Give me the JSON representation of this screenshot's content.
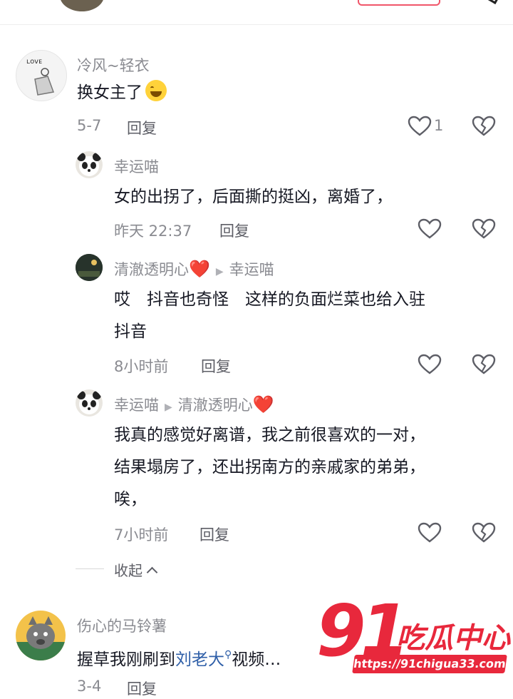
{
  "comments": [
    {
      "username": "冷风~轻衣",
      "text": "换女主了",
      "emoji": "sweat-smile-emoji",
      "time": "5-7",
      "reply": "回复",
      "likes": "1"
    },
    {
      "username": "幸运喵",
      "text": "女的出拐了，后面撕的挺凶，离婚了，",
      "time": "昨天 22:37",
      "reply": "回复"
    },
    {
      "username": "清澈透明心",
      "heart": "❤️",
      "reply_to": "幸运喵",
      "text_line1": "哎　抖音也奇怪　这样的负面烂菜也给入驻",
      "text_line2": "抖音",
      "time": "8小时前",
      "reply": "回复"
    },
    {
      "username": "幸运喵",
      "reply_to": "清澈透明心",
      "heart": "❤️",
      "text_line1": "我真的感觉好离谱，我之前很喜欢的一对，",
      "text_line2": "结果塌房了，还出拐南方的亲戚家的弟弟，",
      "text_line3": "唉，",
      "time": "7小时前",
      "reply": "回复"
    },
    {
      "username": "伤心的马铃薯",
      "text_prefix": "握草我刚刷到",
      "link": "刘老大",
      "text_suffix": "视频…",
      "time": "3-4",
      "reply": "回复"
    }
  ],
  "collapse_label": "收起",
  "watermark": {
    "number": "91",
    "name": "吃瓜中心",
    "url": "https://91chigua33.com"
  },
  "colors": {
    "accent": "#e8283c",
    "link": "#2f5fa8",
    "meta": "#8a8b91"
  }
}
